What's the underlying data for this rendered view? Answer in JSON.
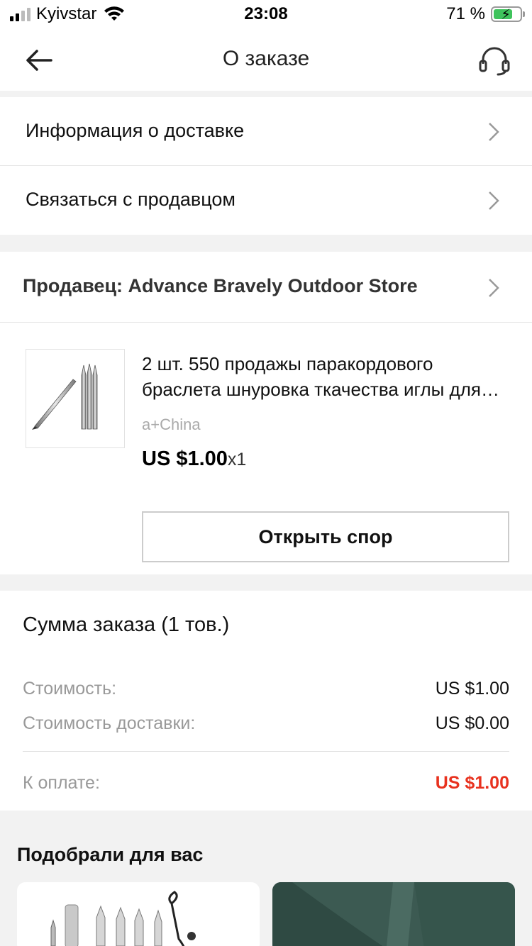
{
  "status_bar": {
    "carrier": "Kyivstar",
    "time": "23:08",
    "battery": "71 %"
  },
  "header": {
    "title": "О заказе"
  },
  "links": [
    {
      "label": "Информация о доставке"
    },
    {
      "label": "Связаться с продавцом"
    }
  ],
  "seller": {
    "label": "Продавец: Advance Bravely Outdoor Store"
  },
  "product": {
    "name": "2 шт. 550 продажы паракордового браслета шнуровка ткачества иглы для паракорда",
    "variant": "a+China",
    "price": "US $1.00",
    "quantity": "x1",
    "dispute_label": "Открыть спор"
  },
  "summary": {
    "heading": "Сумма заказа (1 тов.)",
    "subtotal_label": "Стоимость:",
    "subtotal_value": "US $1.00",
    "shipping_label": "Стоимость доставки:",
    "shipping_value": "US $0.00",
    "total_label": "К оплате:",
    "total_value": "US $1.00",
    "total_color": "#e8321f"
  },
  "recommendations": {
    "title": "Подобрали для вас"
  },
  "icons": [
    "back-arrow-icon",
    "headset-icon",
    "chevron-right-icon",
    "wifi-icon",
    "battery-icon"
  ]
}
